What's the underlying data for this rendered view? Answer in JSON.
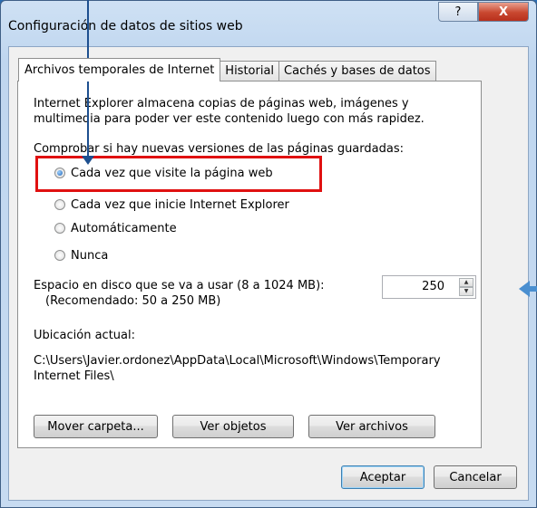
{
  "window": {
    "title": "Configuración de datos de sitios web",
    "help_label": "?",
    "close_label": "X"
  },
  "tabs": [
    {
      "label": "Archivos temporales de Internet"
    },
    {
      "label": "Historial"
    },
    {
      "label": "Cachés y bases de datos"
    }
  ],
  "description": {
    "line1": "Internet Explorer almacena copias de páginas web, imágenes y",
    "line2": "multimedia para poder ver este contenido luego con más rapidez."
  },
  "check_section": {
    "label": "Comprobar si hay nuevas versiones de las páginas guardadas:",
    "options": [
      {
        "label": "Cada vez que visite la página web",
        "checked": true
      },
      {
        "label": "Cada vez que inicie Internet Explorer",
        "checked": false
      },
      {
        "label": "Automáticamente",
        "checked": false
      },
      {
        "label": "Nunca",
        "checked": false
      }
    ]
  },
  "disk_space": {
    "label": "Espacio en disco que se va a usar (8 a 1024 MB):",
    "recommended": "(Recomendado: 50 a 250 MB)",
    "value": "250"
  },
  "location": {
    "label": "Ubicación actual:",
    "path_line1": "C:\\Users\\Javier.ordonez\\AppData\\Local\\Microsoft\\Windows\\Temporary",
    "path_line2": "Internet Files\\"
  },
  "actions": {
    "move_folder": "Mover carpeta...",
    "view_objects": "Ver objetos",
    "view_files": "Ver archivos"
  },
  "footer": {
    "accept": "Aceptar",
    "cancel": "Cancelar"
  },
  "annotations": {
    "highlight_color": "#e01010",
    "arrow_color": "#1d4f8f"
  }
}
